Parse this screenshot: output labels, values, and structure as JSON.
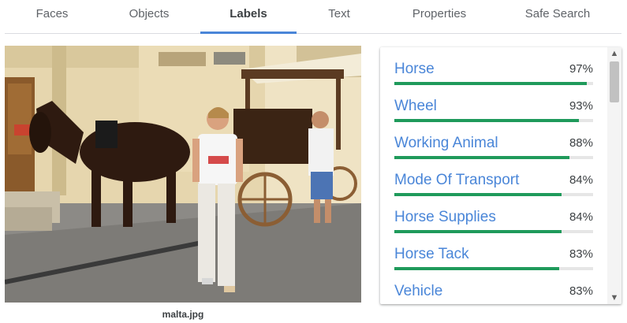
{
  "tabs": [
    {
      "label": "Faces",
      "active": false
    },
    {
      "label": "Objects",
      "active": false
    },
    {
      "label": "Labels",
      "active": true
    },
    {
      "label": "Text",
      "active": false
    },
    {
      "label": "Properties",
      "active": false
    },
    {
      "label": "Safe Search",
      "active": false
    }
  ],
  "image": {
    "filename": "malta.jpg"
  },
  "labels": [
    {
      "name": "Horse",
      "score": "97%",
      "fraction": 0.97
    },
    {
      "name": "Wheel",
      "score": "93%",
      "fraction": 0.93
    },
    {
      "name": "Working Animal",
      "score": "88%",
      "fraction": 0.88
    },
    {
      "name": "Mode Of Transport",
      "score": "84%",
      "fraction": 0.84
    },
    {
      "name": "Horse Supplies",
      "score": "84%",
      "fraction": 0.84
    },
    {
      "name": "Horse Tack",
      "score": "83%",
      "fraction": 0.83
    },
    {
      "name": "Vehicle",
      "score": "83%",
      "fraction": 0.83
    }
  ],
  "colors": {
    "accent": "#4a86d8",
    "bar_fill": "#1f9a5b",
    "bar_track": "#e6e6e6"
  },
  "icons": {
    "scroll_up": "chevron-up-icon",
    "scroll_down": "chevron-down-icon"
  }
}
